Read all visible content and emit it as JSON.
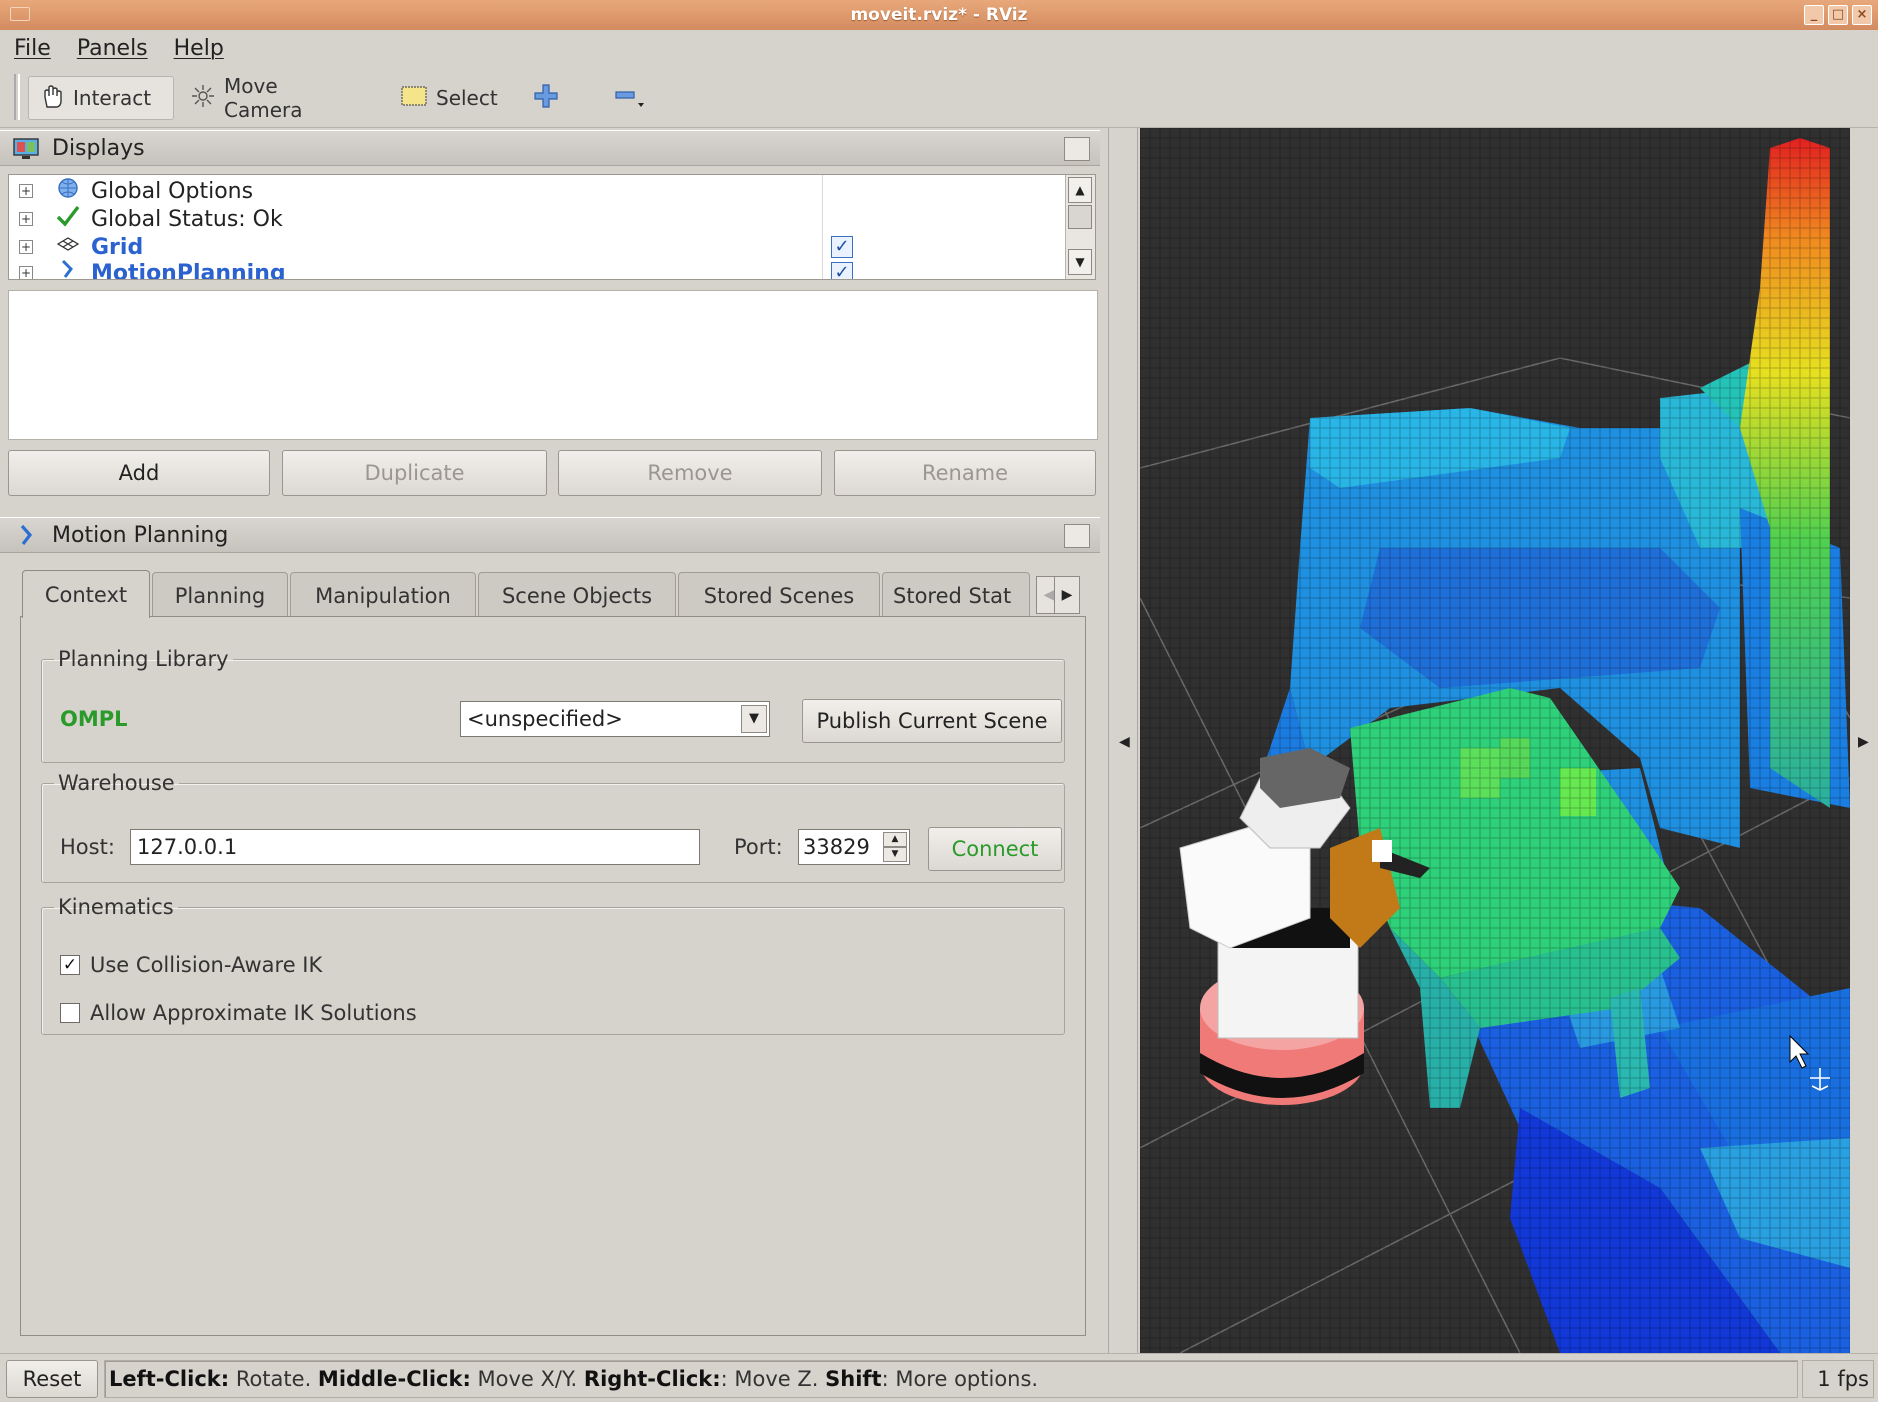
{
  "window": {
    "title": "moveit.rviz* - RViz"
  },
  "menu": {
    "file": "File",
    "panels": "Panels",
    "help": "Help"
  },
  "toolbar": {
    "interact": "Interact",
    "move_camera": "Move Camera",
    "select": "Select"
  },
  "displays": {
    "title": "Displays",
    "items": [
      {
        "label": "Global Options",
        "icon": "globe-icon",
        "checked": null
      },
      {
        "label": "Global Status: Ok",
        "icon": "checkmark-icon",
        "checked": null
      },
      {
        "label": "Grid",
        "icon": "grid-icon",
        "checked": true
      },
      {
        "label": "MotionPlanning",
        "icon": "motion-planning-icon",
        "checked": true
      }
    ],
    "buttons": {
      "add": "Add",
      "duplicate": "Duplicate",
      "remove": "Remove",
      "rename": "Rename"
    }
  },
  "motion_planning": {
    "title": "Motion Planning",
    "tabs": [
      "Context",
      "Planning",
      "Manipulation",
      "Scene Objects",
      "Stored Scenes",
      "Stored Stat"
    ],
    "active_tab": "Context",
    "planning_library": {
      "legend": "Planning Library",
      "library": "OMPL",
      "planner_selected": "<unspecified>",
      "publish_button": "Publish Current Scene"
    },
    "warehouse": {
      "legend": "Warehouse",
      "host_label": "Host:",
      "host_value": "127.0.0.1",
      "port_label": "Port:",
      "port_value": "33829",
      "connect_button": "Connect"
    },
    "kinematics": {
      "legend": "Kinematics",
      "collision_aware_ik": {
        "label": "Use Collision-Aware IK",
        "checked": true
      },
      "approximate_ik": {
        "label": "Allow Approximate IK Solutions",
        "checked": false
      }
    }
  },
  "status": {
    "reset": "Reset",
    "hint_left_key": "Left-Click:",
    "hint_left": " Rotate. ",
    "hint_middle_key": "Middle-Click:",
    "hint_middle": " Move X/Y. ",
    "hint_right_key": "Right-Click:",
    "hint_right": ": Move Z. ",
    "hint_shift_key": "Shift",
    "hint_shift": ": More options.",
    "fps": "1 fps"
  },
  "colors": {
    "accent_green": "#2a9a2a",
    "link_blue": "#2b62d0",
    "titlebar": "#d38b60",
    "viewport_bg": "#303030"
  }
}
